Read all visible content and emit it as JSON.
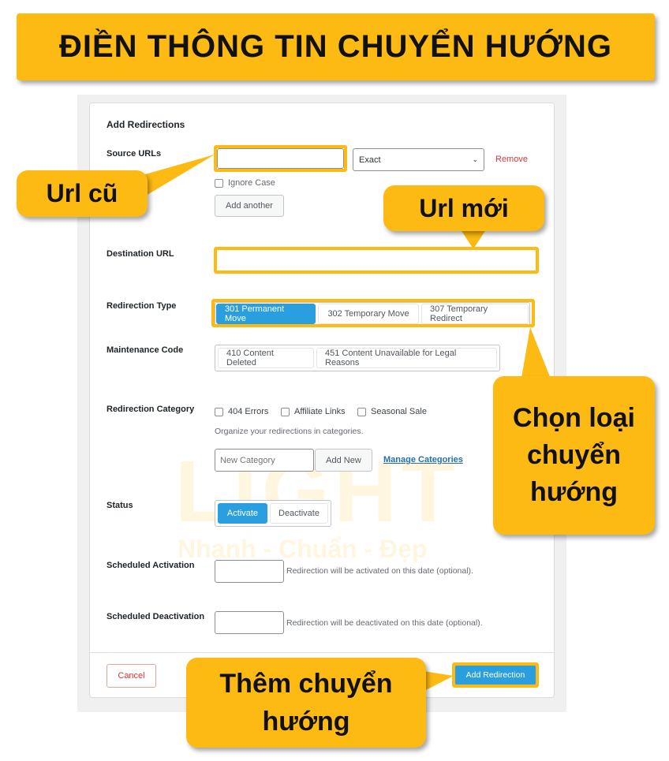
{
  "banner": {
    "title": "ĐIỀN THÔNG TIN CHUYỂN HƯỚNG"
  },
  "watermark": {
    "logo": "LIGHT",
    "tagline": "Nhanh - Chuẩn - Đẹp"
  },
  "form": {
    "title": "Add Redirections",
    "source": {
      "label": "Source URLs",
      "value": "",
      "match": "Exact",
      "remove": "Remove",
      "ignore_case": "Ignore Case",
      "add_another": "Add another"
    },
    "destination": {
      "label": "Destination URL",
      "value": ""
    },
    "redirection_type": {
      "label": "Redirection Type",
      "options": [
        "301 Permanent Move",
        "302 Temporary Move",
        "307 Temporary Redirect"
      ],
      "selected": "301 Permanent Move"
    },
    "maintenance": {
      "label": "Maintenance Code",
      "options": [
        "410 Content Deleted",
        "451 Content Unavailable for Legal Reasons"
      ]
    },
    "category": {
      "label": "Redirection Category",
      "options": [
        "404 Errors",
        "Affiliate Links",
        "Seasonal Sale"
      ],
      "help": "Organize your redirections in categories.",
      "new_placeholder": "New Category",
      "add_new": "Add New",
      "manage": "Manage Categories"
    },
    "status": {
      "label": "Status",
      "options": [
        "Activate",
        "Deactivate"
      ],
      "selected": "Activate"
    },
    "sched_act": {
      "label": "Scheduled Activation",
      "help": "Redirection will be activated on this date (optional)."
    },
    "sched_deact": {
      "label": "Scheduled Deactivation",
      "help": "Redirection will be deactivated on this date (optional)."
    },
    "cancel": "Cancel",
    "submit": "Add Redirection"
  },
  "callouts": {
    "old_url": "Url cũ",
    "new_url": "Url mới",
    "choose_type": "Chọn loại chuyển hướng",
    "add": "Thêm chuyển hướng"
  },
  "colors": {
    "accent": "#fdba12",
    "primary": "#2a9fe0",
    "danger": "#d63638"
  }
}
